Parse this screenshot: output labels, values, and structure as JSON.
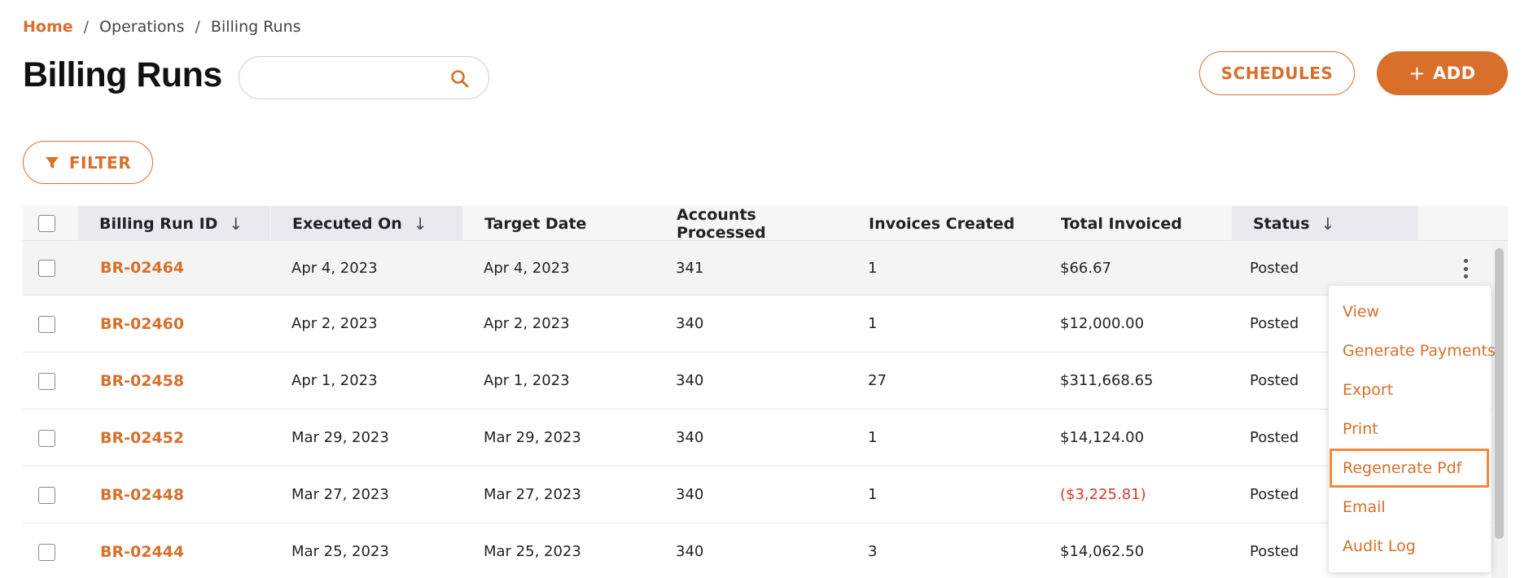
{
  "breadcrumb": {
    "home": "Home",
    "separator": "/",
    "items": [
      "Operations",
      "Billing Runs"
    ]
  },
  "page": {
    "title": "Billing Runs"
  },
  "search": {
    "placeholder": "",
    "value": ""
  },
  "actions": {
    "schedules_label": "SCHEDULES",
    "add_label": "ADD",
    "filter_label": "FILTER"
  },
  "table": {
    "columns": [
      {
        "label": "Billing Run ID",
        "sortable": true
      },
      {
        "label": "Executed On",
        "sortable": true
      },
      {
        "label": "Target Date",
        "sortable": false
      },
      {
        "label": "Accounts Processed",
        "sortable": false
      },
      {
        "label": "Invoices Created",
        "sortable": false
      },
      {
        "label": "Total Invoiced",
        "sortable": false
      },
      {
        "label": "Status",
        "sortable": true
      }
    ],
    "sort_arrow": "↓",
    "rows": [
      {
        "id": "BR-02464",
        "executed": "Apr 4, 2023",
        "target": "Apr 4, 2023",
        "accounts": "341",
        "invoices": "1",
        "total": "$66.67",
        "status": "Posted"
      },
      {
        "id": "BR-02460",
        "executed": "Apr 2, 2023",
        "target": "Apr 2, 2023",
        "accounts": "340",
        "invoices": "1",
        "total": "$12,000.00",
        "status": "Posted"
      },
      {
        "id": "BR-02458",
        "executed": "Apr 1, 2023",
        "target": "Apr 1, 2023",
        "accounts": "340",
        "invoices": "27",
        "total": "$311,668.65",
        "status": "Posted"
      },
      {
        "id": "BR-02452",
        "executed": "Mar 29, 2023",
        "target": "Mar 29, 2023",
        "accounts": "340",
        "invoices": "1",
        "total": "$14,124.00",
        "status": "Posted"
      },
      {
        "id": "BR-02448",
        "executed": "Mar 27, 2023",
        "target": "Mar 27, 2023",
        "accounts": "340",
        "invoices": "1",
        "total": "($3,225.81)",
        "status": "Posted"
      },
      {
        "id": "BR-02444",
        "executed": "Mar 25, 2023",
        "target": "Mar 25, 2023",
        "accounts": "340",
        "invoices": "3",
        "total": "$14,062.50",
        "status": "Posted"
      }
    ]
  },
  "row_menu": {
    "items": [
      "View",
      "Generate Payments",
      "Export",
      "Print",
      "Regenerate Pdf",
      "Email",
      "Audit Log"
    ],
    "highlighted": "Regenerate Pdf"
  },
  "colors": {
    "accent": "#d86f2b",
    "negative": "#d83a2b",
    "highlight_outline": "#ef8a3a"
  },
  "icons": {
    "search": "search-icon",
    "filter": "filter-icon",
    "more": "more-vertical-icon"
  }
}
